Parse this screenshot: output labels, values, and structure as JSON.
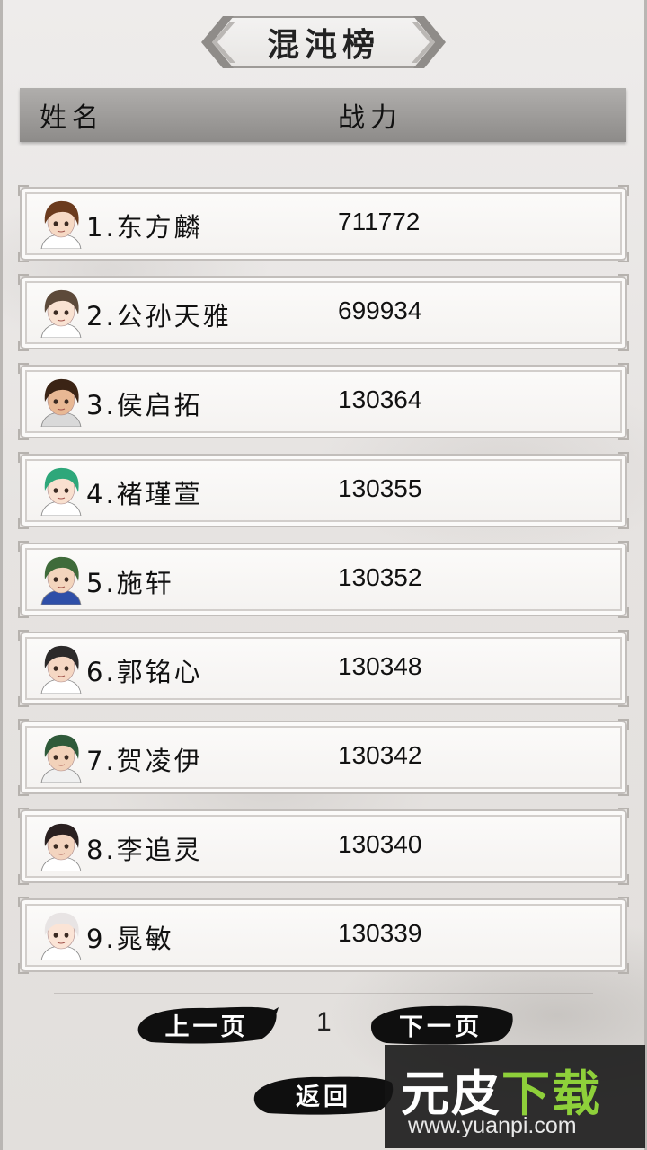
{
  "title": "混沌榜",
  "header": {
    "name_label": "姓名",
    "power_label": "战力"
  },
  "rankings": [
    {
      "name": "1.东方麟",
      "power": "711772",
      "avatar": {
        "hair": "#6b3b1e",
        "skin": "#f6d9c4",
        "cloth": "#ffffff"
      }
    },
    {
      "name": "2.公孙天雅",
      "power": "699934",
      "avatar": {
        "hair": "#5d4a3a",
        "skin": "#f9e2d2",
        "cloth": "#ffffff"
      }
    },
    {
      "name": "3.侯启拓",
      "power": "130364",
      "avatar": {
        "hair": "#3b2415",
        "skin": "#e8b894",
        "cloth": "#d9d9d9"
      }
    },
    {
      "name": "4.褚瑾萱",
      "power": "130355",
      "avatar": {
        "hair": "#2ea77a",
        "skin": "#f9e0cf",
        "cloth": "#ffffff"
      }
    },
    {
      "name": "5.施轩",
      "power": "130352",
      "avatar": {
        "hair": "#3f6b3a",
        "skin": "#f3d5bd",
        "cloth": "#2f4fa8"
      }
    },
    {
      "name": "6.郭铭心",
      "power": "130348",
      "avatar": {
        "hair": "#2c2a2a",
        "skin": "#f5d7c3",
        "cloth": "#ffffff"
      }
    },
    {
      "name": "7.贺凌伊",
      "power": "130342",
      "avatar": {
        "hair": "#2f5a3a",
        "skin": "#f2d2ba",
        "cloth": "#f0f0f0"
      }
    },
    {
      "name": "8.李追灵",
      "power": "130340",
      "avatar": {
        "hair": "#2a2020",
        "skin": "#f3d4bf",
        "cloth": "#ffffff"
      }
    },
    {
      "name": "9.晁敏",
      "power": "130339",
      "avatar": {
        "hair": "#e8e4e4",
        "skin": "#fbe4d6",
        "cloth": "#ffffff"
      }
    }
  ],
  "pagination": {
    "prev_label": "上一页",
    "page": "1",
    "next_label": "下一页"
  },
  "back_label": "返回",
  "watermark": {
    "logo_main": "元皮",
    "logo_accent": "下载",
    "url": "www.yuanpi.com"
  },
  "icons": {
    "title_left": "chevron-left-icon",
    "title_right": "chevron-right-icon"
  }
}
